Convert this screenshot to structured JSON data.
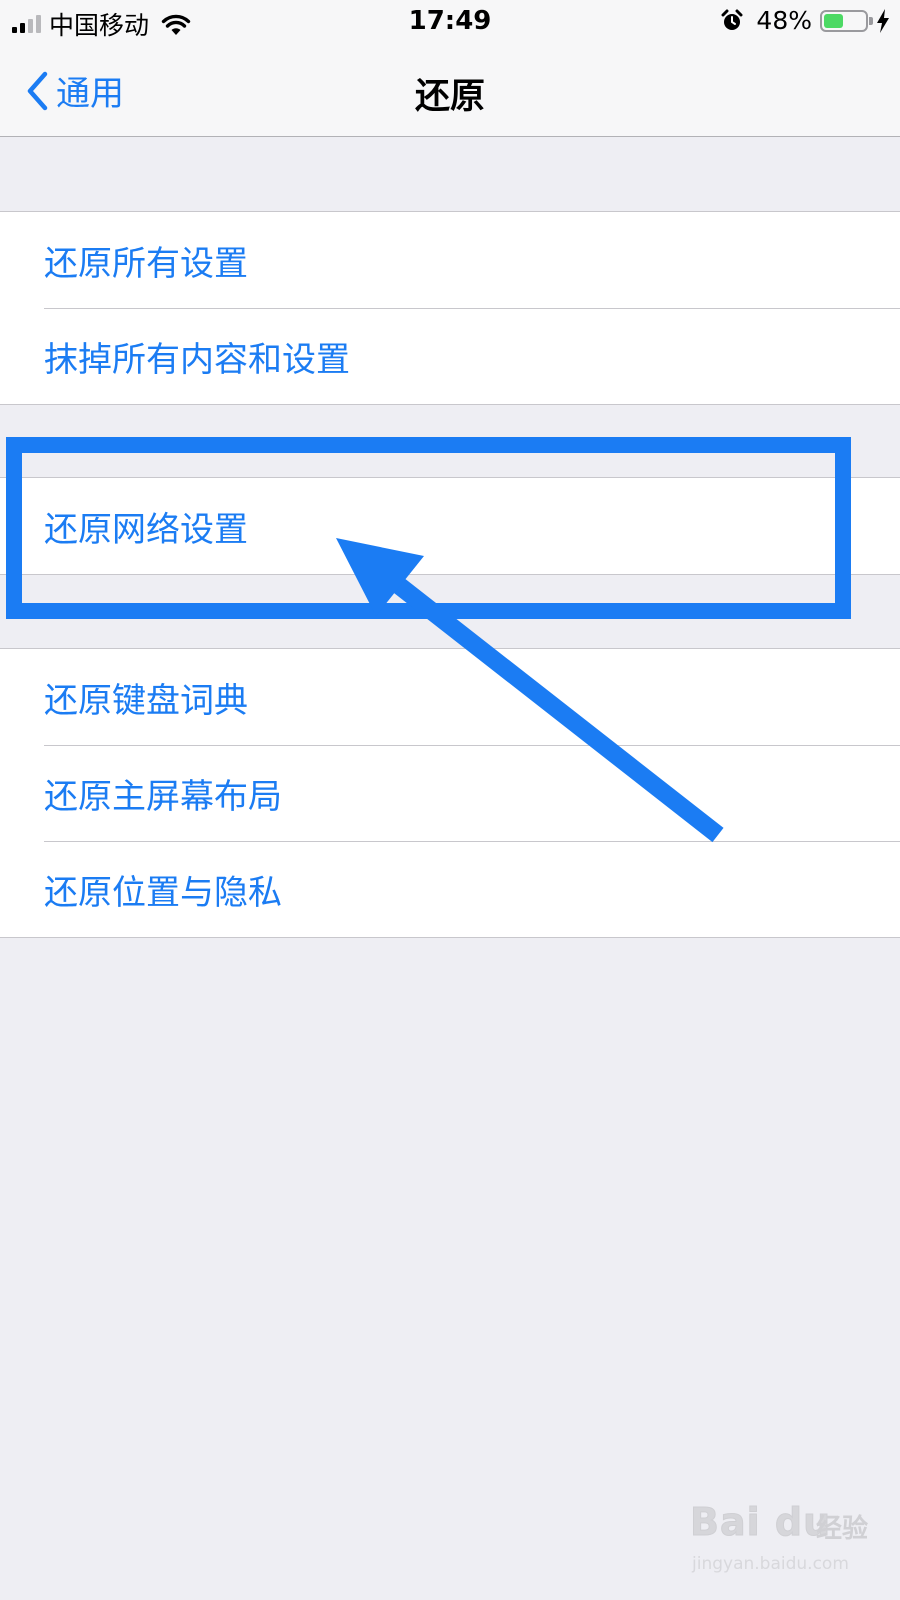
{
  "status_bar": {
    "carrier": "中国移动",
    "time": "17:49",
    "battery_percent": "48%",
    "battery_level": 0.48,
    "icons": [
      "signal-icon",
      "wifi-icon",
      "alarm-icon",
      "battery-icon",
      "charging-bolt-icon"
    ]
  },
  "nav": {
    "back_label": "通用",
    "title": "还原",
    "back_icon": "chevron-left-icon"
  },
  "groups": [
    {
      "items": [
        "还原所有设置",
        "抹掉所有内容和设置"
      ]
    },
    {
      "items": [
        "还原网络设置"
      ]
    },
    {
      "items": [
        "还原键盘词典",
        "还原主屏幕布局",
        "还原位置与隐私"
      ]
    }
  ],
  "annotation": {
    "highlight_color": "#1b7cf3",
    "highlighted_item": "还原网络设置"
  },
  "watermark": {
    "logo_text": "Bai du",
    "suffix_text": "经验",
    "url": "jingyan.baidu.com"
  },
  "colors": {
    "accent": "#1b7cf3",
    "background": "#eeeef3",
    "battery_fill": "#4cd964"
  }
}
